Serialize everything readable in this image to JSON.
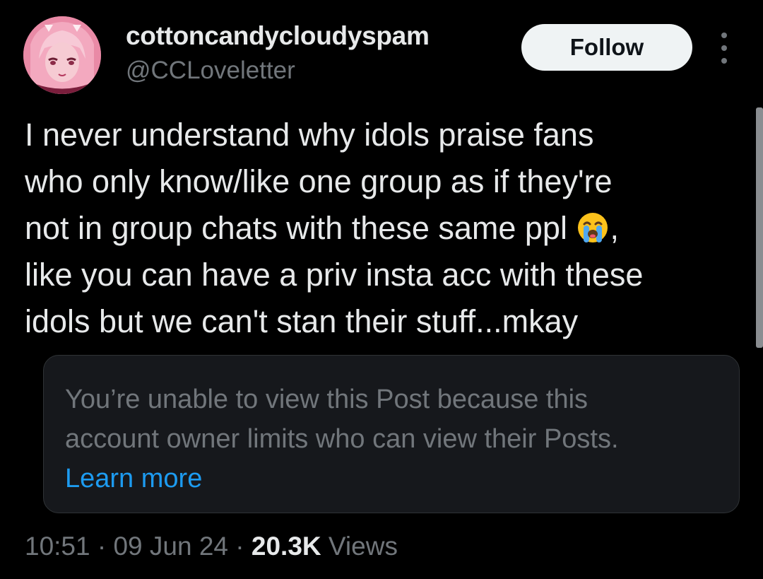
{
  "author": {
    "display_name": "cottoncandycloudyspam",
    "handle": "@CCLoveletter",
    "avatar_icon": "anime-girl-pink-avatar"
  },
  "header": {
    "follow_label": "Follow",
    "more_icon": "more-vertical-icon"
  },
  "tweet": {
    "lines": [
      "I never understand why idols praise fans",
      "who only know/like one group as if they're",
      "not in group chats with these same ppl",
      "like you can have a priv insta acc with these",
      "idols but we can't stan their stuff...mkay"
    ],
    "line3_suffix": ",",
    "emoji": "loudly-crying-face-icon"
  },
  "notice": {
    "lines": [
      "You’re unable to view this Post because this",
      "account owner limits who can view their Posts."
    ],
    "link_label": "Learn more"
  },
  "meta": {
    "time": "10:51",
    "separator": " · ",
    "date": "09 Jun 24",
    "views_count": "20.3K",
    "views_label": " Views"
  },
  "colors": {
    "background": "#000000",
    "text_primary": "#e7e9ea",
    "text_secondary": "#71767b",
    "link": "#1d9bf0",
    "card_bg": "#16181c"
  }
}
